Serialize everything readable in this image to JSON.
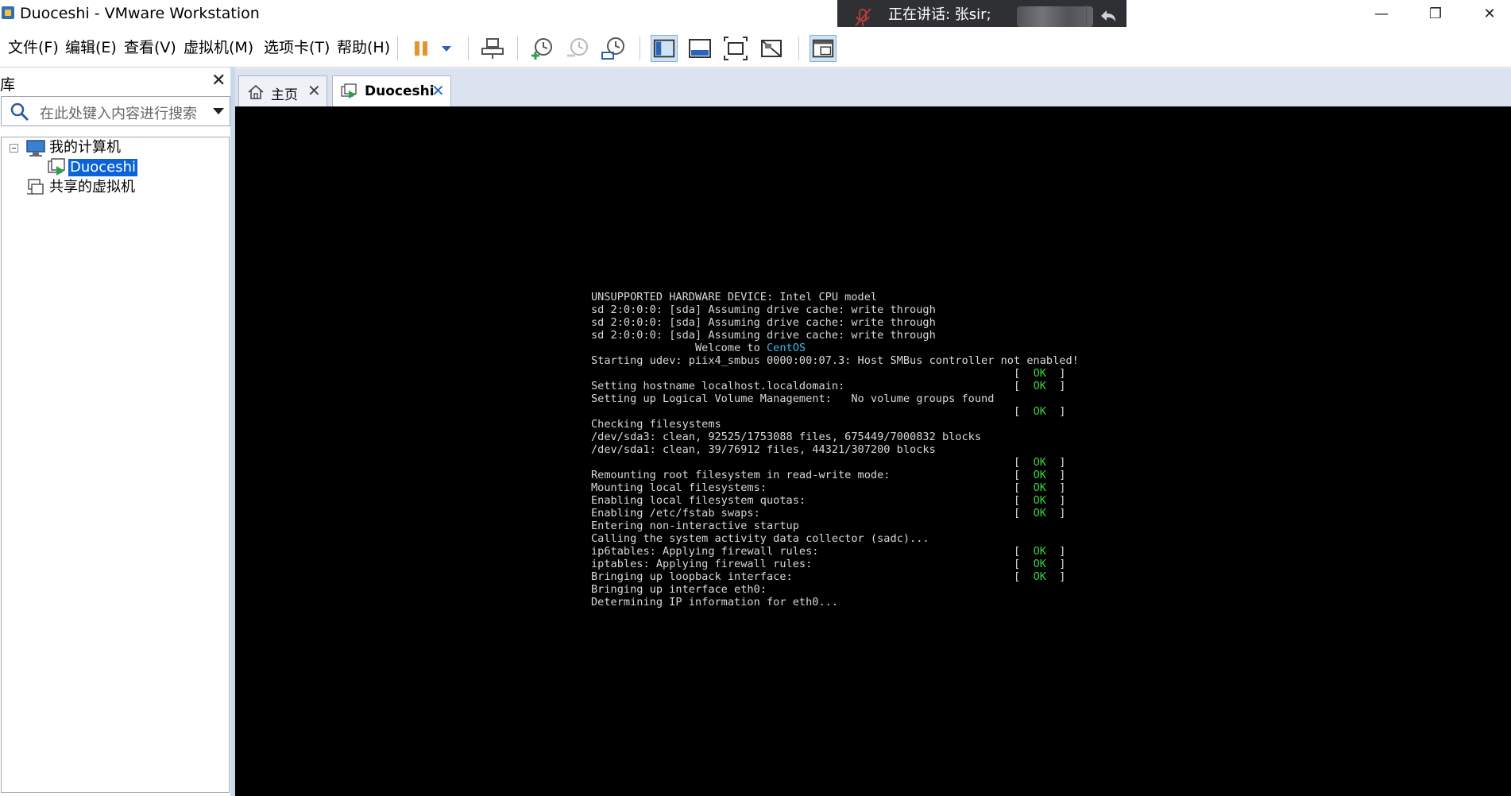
{
  "window": {
    "title": "Duoceshi - VMware Workstation",
    "minimize": "—",
    "restore": "❐",
    "close": "✕"
  },
  "meeting": {
    "speaking_label": "正在讲话: 张sir;"
  },
  "menu": [
    {
      "key": "file",
      "label": "文件(F)"
    },
    {
      "key": "edit",
      "label": "编辑(E)"
    },
    {
      "key": "view",
      "label": "查看(V)"
    },
    {
      "key": "vm",
      "label": "虚拟机(M)"
    },
    {
      "key": "tabs",
      "label": "选项卡(T)"
    },
    {
      "key": "help",
      "label": "帮助(H)"
    }
  ],
  "toolbar": {
    "icons": [
      "pause-icon",
      "dropdown-arrow-icon",
      "send-ctrl-alt-del-icon",
      "snapshot-take-icon",
      "snapshot-revert-icon",
      "snapshot-manager-icon",
      "show-library-icon",
      "thumbnail-bar-icon",
      "fullscreen-icon",
      "unity-icon",
      "console-view-icon"
    ]
  },
  "library": {
    "title": "库",
    "close": "✕",
    "search_placeholder": "在此处键入内容进行搜索",
    "tree": {
      "my_computer": "我的计算机",
      "vm": "Duoceshi",
      "shared": "共享的虚拟机"
    }
  },
  "tabs": [
    {
      "label": "主页",
      "icon": "home-icon",
      "active": false
    },
    {
      "label": "Duoceshi",
      "icon": "vm-running-icon",
      "active": true
    }
  ],
  "colors": {
    "ok_green": "#39d43b",
    "centos_cyan": "#35b7e8",
    "selection_blue": "#0a64d8"
  },
  "console": {
    "lines": [
      {
        "text": "UNSUPPORTED HARDWARE DEVICE: Intel CPU model"
      },
      {
        "text": "sd 2:0:0:0: [sda] Assuming drive cache: write through"
      },
      {
        "text": "sd 2:0:0:0: [sda] Assuming drive cache: write through"
      },
      {
        "text": "sd 2:0:0:0: [sda] Assuming drive cache: write through"
      },
      {
        "text": "                Welcome to ",
        "highlight": "CentOS"
      },
      {
        "text": "Starting udev: piix4_smbus 0000:00:07.3: Host SMBus controller not enabled!"
      },
      {
        "text": "",
        "ok": true
      },
      {
        "text": "Setting hostname localhost.localdomain:",
        "ok": true
      },
      {
        "text": "Setting up Logical Volume Management:   No volume groups found"
      },
      {
        "text": "",
        "ok": true
      },
      {
        "text": "Checking filesystems"
      },
      {
        "text": "/dev/sda3: clean, 92525/1753088 files, 675449/7000832 blocks"
      },
      {
        "text": "/dev/sda1: clean, 39/76912 files, 44321/307200 blocks"
      },
      {
        "text": "",
        "ok": true
      },
      {
        "text": "Remounting root filesystem in read-write mode:",
        "ok": true
      },
      {
        "text": "Mounting local filesystems:",
        "ok": true
      },
      {
        "text": "Enabling local filesystem quotas:",
        "ok": true
      },
      {
        "text": "Enabling /etc/fstab swaps:",
        "ok": true
      },
      {
        "text": "Entering non-interactive startup"
      },
      {
        "text": "Calling the system activity data collector (sadc)..."
      },
      {
        "text": "ip6tables: Applying firewall rules:",
        "ok": true
      },
      {
        "text": "iptables: Applying firewall rules:",
        "ok": true
      },
      {
        "text": "Bringing up loopback interface:",
        "ok": true
      },
      {
        "text": "Bringing up interface eth0:"
      },
      {
        "text": "Determining IP information for eth0..."
      }
    ],
    "ok_text": "OK"
  }
}
